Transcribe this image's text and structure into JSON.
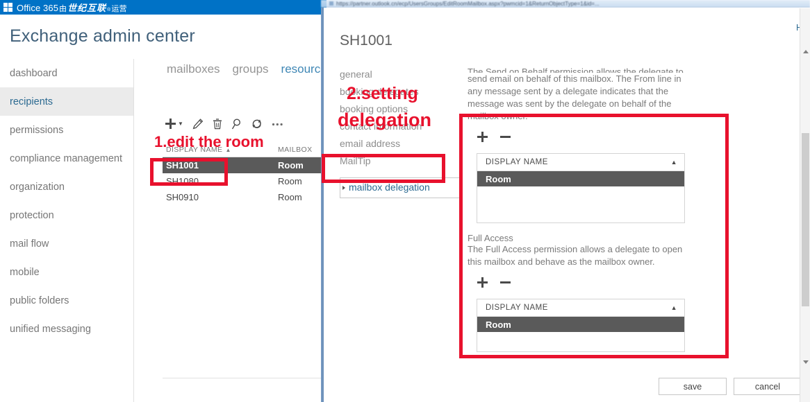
{
  "suite_bar": {
    "waffle_icon": "app-launcher-icon",
    "brand_office": "Office 365",
    "brand_cn_prefix": "由",
    "brand_cn_bold": "世纪互联",
    "brand_cn_sup": "®",
    "brand_cn_suffix": "运营"
  },
  "page": {
    "title": "Exchange admin center"
  },
  "sidebar": {
    "items": [
      {
        "label": "dashboard",
        "selected": false
      },
      {
        "label": "recipients",
        "selected": true
      },
      {
        "label": "permissions",
        "selected": false
      },
      {
        "label": "compliance management",
        "selected": false
      },
      {
        "label": "organization",
        "selected": false
      },
      {
        "label": "protection",
        "selected": false
      },
      {
        "label": "mail flow",
        "selected": false
      },
      {
        "label": "mobile",
        "selected": false
      },
      {
        "label": "public folders",
        "selected": false
      },
      {
        "label": "unified messaging",
        "selected": false
      }
    ]
  },
  "tabs": [
    {
      "label": "mailboxes",
      "active": false
    },
    {
      "label": "groups",
      "active": false
    },
    {
      "label": "resources",
      "active": true
    }
  ],
  "toolbar": {
    "new_label": "new",
    "new_icon": "plus-icon",
    "new_caret_icon": "chevron-down-icon",
    "edit_icon": "pencil-icon",
    "delete_icon": "trash-icon",
    "search_icon": "search-icon",
    "refresh_icon": "refresh-icon",
    "more_icon": "ellipsis-icon"
  },
  "list": {
    "columns": [
      "DISPLAY NAME",
      "MAILBOX"
    ],
    "sort_icon": "sort-ascending-icon",
    "rows": [
      {
        "display_name": "SH1001",
        "mailbox": "Room",
        "selected": true
      },
      {
        "display_name": "SH1080",
        "mailbox": "Room",
        "selected": false
      },
      {
        "display_name": "SH0910",
        "mailbox": "Room",
        "selected": false
      }
    ]
  },
  "dialog": {
    "url_bar_text": "https://partner.outlook.cn/ecp/UsersGroups/EditRoomMailbox.aspx?pwmcid=1&ReturnObjectType=1&id=...",
    "help_label": "Hel",
    "title": "SH1001",
    "nav_items": [
      {
        "label": "general",
        "active": false
      },
      {
        "label": "booking delegates",
        "active": false
      },
      {
        "label": "booking options",
        "active": false
      },
      {
        "label": "contact information",
        "active": false
      },
      {
        "label": "email address",
        "active": false
      },
      {
        "label": "MailTip",
        "active": false
      },
      {
        "label": "mailbox delegation",
        "active": true
      }
    ],
    "nav_active_arrow_icon": "triangle-right-icon",
    "send_on_behalf": {
      "description_line1": "The Send on Behalf permission allows the delegate to",
      "description": "send email on behalf of this mailbox. The From line in any message sent by a delegate indicates that the message was sent by the delegate on behalf of the mailbox owner.",
      "add_icon": "plus-icon",
      "remove_icon": "minus-icon",
      "grid_header": "DISPLAY NAME",
      "grid_sort_icon": "sort-ascending-icon",
      "rows": [
        "Room"
      ]
    },
    "full_access": {
      "heading": "Full Access",
      "description": "The Full Access permission allows a delegate to open this mailbox and behave as the mailbox owner.",
      "add_icon": "plus-icon",
      "remove_icon": "minus-icon",
      "grid_header": "DISPLAY NAME",
      "grid_sort_icon": "sort-ascending-icon",
      "rows": [
        "Room"
      ]
    },
    "footer": {
      "save_label": "save",
      "cancel_label": "cancel"
    }
  },
  "annotations": [
    {
      "name": "annotation-edit-the-room",
      "text": "1.edit the room"
    },
    {
      "name": "annotation-setting-line1",
      "text": "2.setting"
    },
    {
      "name": "annotation-setting-line2",
      "text": "delegation"
    }
  ],
  "colors": {
    "suite_bar_blue": "#0072c6",
    "accent_blue": "#2c6a91",
    "annotation_red": "#e8112d",
    "selected_row_gray": "#5a5a5a",
    "nav_selected_bg": "#ebebeb"
  }
}
